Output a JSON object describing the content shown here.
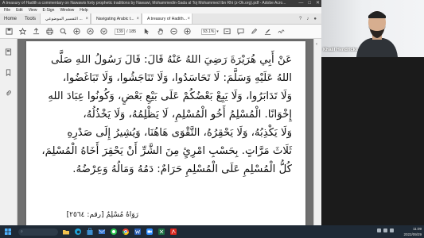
{
  "window": {
    "title": "A treasury of Hadith a commentary on Nawawis forty prophetic traditions by Nawawi, Mohammedin-Sada al Toj Mohammed Ibn Rhi (z-Ok.org).pdf - Adobe Acro...",
    "controls": [
      "—",
      "□",
      "✕"
    ]
  },
  "menu": [
    "File",
    "Edit",
    "View",
    "E-Sign",
    "Window",
    "Help"
  ],
  "tabs": {
    "home": "Home",
    "tools": "Tools",
    "docs": [
      {
        "label": "التفسير الموضوعي ..."
      },
      {
        "label": "Navigating Arabic t..."
      },
      {
        "label": "A treasury of Hadith..."
      }
    ]
  },
  "toolbar": {
    "page_current": "139",
    "page_total": "/ 185",
    "zoom": "93.1%"
  },
  "document": {
    "hadith_lines": [
      "عَنْ أَبِي هُرَيْرَةَ رَضِيَ اللهُ عَنْهُ قَالَ: قَالَ رَسُولُ اللهِ صَلَّى",
      "اللهُ عَلَيْهِ وَسَلَّمَ: لَا تَحَاسَدُوا، وَلَا تَنَاجَشُوا، وَلَا تَبَاغَضُوا،",
      "وَلَا تَدَابَرُوا، وَلَا يَبِعْ بَعْضُكُمْ عَلَى بَيْعِ بَعْضٍ، وَكُونُوا عِبَادَ اللهِ",
      "إِخْوَانًا. الْمُسْلِمُ أَخُو الْمُسْلِمِ، لَا يَظْلِمُهُ، وَلَا يَخْذُلُهُ،",
      "وَلَا يَكْذِبُهُ، وَلَا يَحْقِرُهُ، التَّقْوَى هَاهُنَا، وَيُشِيرُ إِلَى صَدْرِهِ",
      "ثَلَاثَ مَرَّاتٍ. بِحَسْبِ امْرِئٍ مِنَ الشَّرِّ أَنْ يَحْقِرَ أَخَاهُ الْمُسْلِمَ،",
      "كُلُّ الْمُسْلِمِ عَلَى الْمُسْلِمِ حَرَامٌ: دَمُهُ وَمَالُهُ وَعِرْضُهُ."
    ],
    "source": "رَوَاهُ مُسْلِمٌ [رقم: ٢٥٦٤]"
  },
  "video": {
    "participant_name": "Khalil Hendricks"
  },
  "taskbar": {
    "search_placeholder": "",
    "time": "11:09",
    "date": "2022/09/29"
  },
  "colors": {
    "page_bg": "#ffffff",
    "viewer_bg": "#6f6f6f",
    "taskbar_bg": "#1f2a36"
  }
}
